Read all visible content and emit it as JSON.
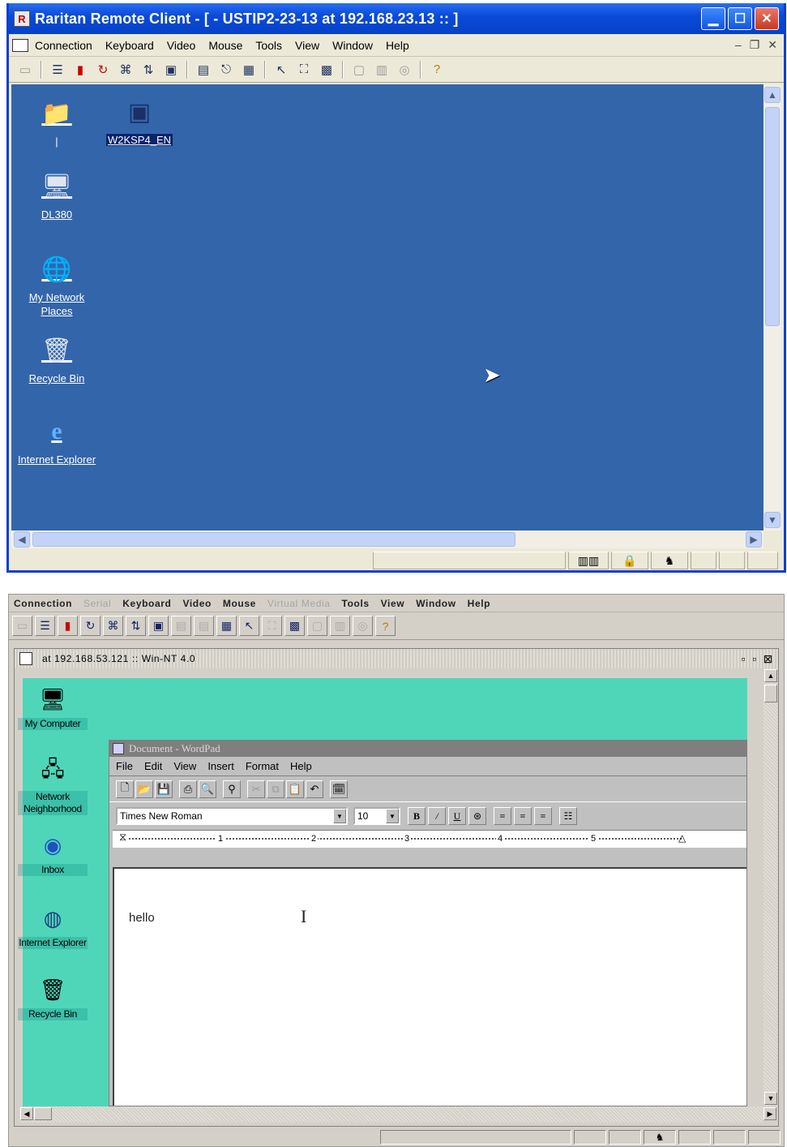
{
  "top": {
    "title": "Raritan Remote Client - [ - USTIP2-23-13 at 192.168.23.13 :: ]",
    "menu": [
      "Connection",
      "Keyboard",
      "Video",
      "Mouse",
      "Tools",
      "View",
      "Window",
      "Help"
    ],
    "desktop_icons": [
      {
        "label": "|",
        "icon": "folder-icon"
      },
      {
        "label": "W2KSP4_EN",
        "icon": "window-icon"
      },
      {
        "label": "DL380",
        "icon": "computer-icon"
      },
      {
        "label": "My Network Places",
        "icon": "network-icon"
      },
      {
        "label": "Recycle Bin",
        "icon": "recycle-bin-icon"
      },
      {
        "label": "Internet Explorer",
        "icon": "ie-icon"
      }
    ]
  },
  "bottom": {
    "menu": [
      {
        "label": "Connection",
        "enabled": true
      },
      {
        "label": "Serial",
        "enabled": false
      },
      {
        "label": "Keyboard",
        "enabled": true
      },
      {
        "label": "Video",
        "enabled": true
      },
      {
        "label": "Mouse",
        "enabled": true
      },
      {
        "label": "Virtual Media",
        "enabled": false
      },
      {
        "label": "Tools",
        "enabled": true
      },
      {
        "label": "View",
        "enabled": true
      },
      {
        "label": "Window",
        "enabled": true
      },
      {
        "label": "Help",
        "enabled": true
      }
    ],
    "inner_title": "at 192.168.53.121 :: Win-NT 4.0",
    "desktop_icons": [
      {
        "label": "My Computer",
        "icon": "computer-icon"
      },
      {
        "label": "Network Neighborhood",
        "icon": "network-icon"
      },
      {
        "label": "Inbox",
        "icon": "inbox-icon"
      },
      {
        "label": "Internet Explorer",
        "icon": "ie-icon"
      },
      {
        "label": "Recycle Bin",
        "icon": "recycle-bin-icon"
      }
    ],
    "wordpad": {
      "title": "Document - WordPad",
      "menu": [
        "File",
        "Edit",
        "View",
        "Insert",
        "Format",
        "Help"
      ],
      "font": "Times New Roman",
      "size": "10",
      "ruler": [
        "1",
        "2",
        "3",
        "4",
        "5"
      ],
      "text": "hello"
    }
  }
}
